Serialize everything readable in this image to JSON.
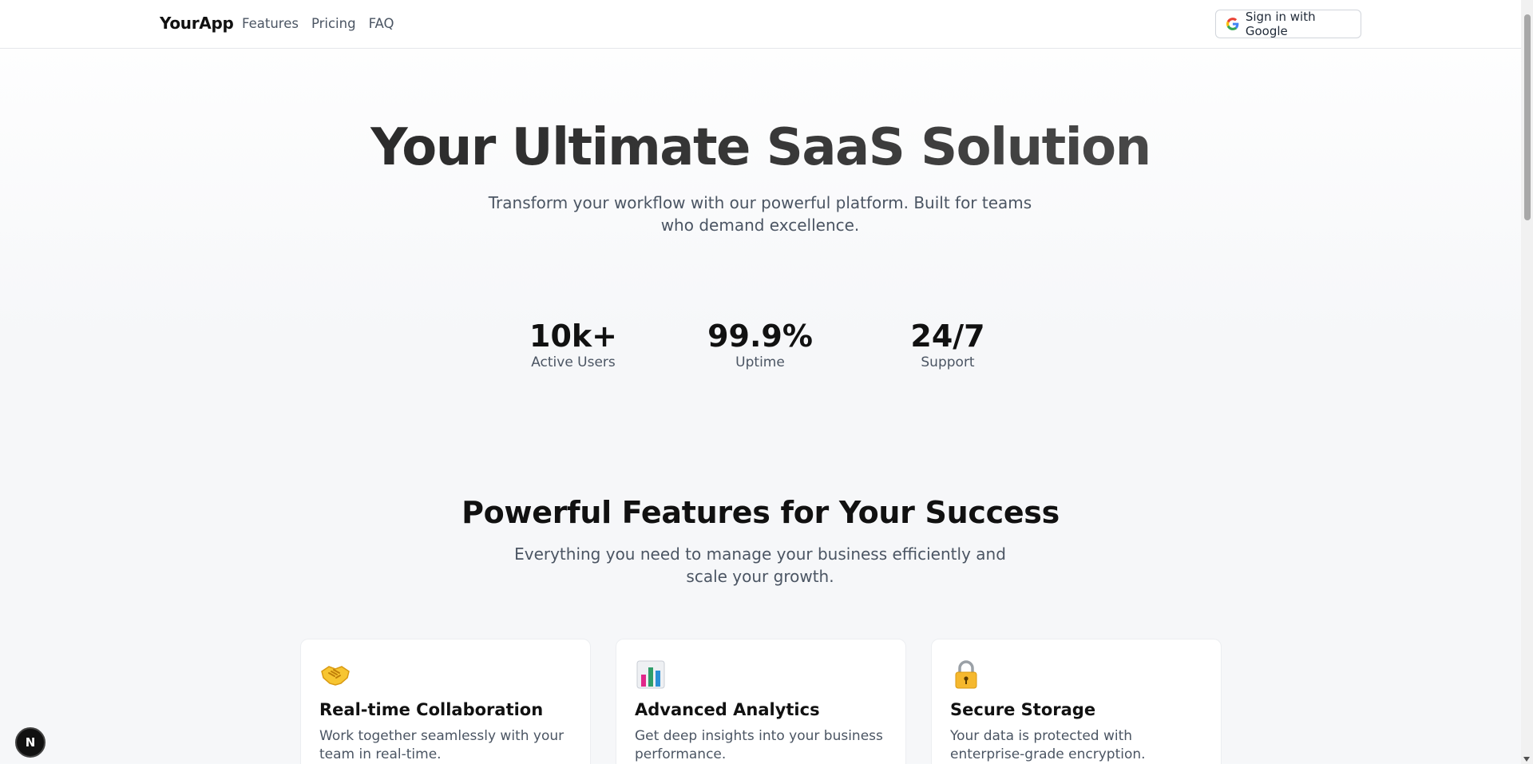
{
  "header": {
    "brand": "YourApp",
    "nav": [
      "Features",
      "Pricing",
      "FAQ"
    ],
    "signin_label": "Sign in with Google"
  },
  "hero": {
    "title": "Your Ultimate SaaS Solution",
    "subtitle": "Transform your workflow with our powerful platform. Built for teams who demand excellence."
  },
  "stats": [
    {
      "value": "10k+",
      "label": "Active Users"
    },
    {
      "value": "99.9%",
      "label": "Uptime"
    },
    {
      "value": "24/7",
      "label": "Support"
    }
  ],
  "features": {
    "title": "Powerful Features for Your Success",
    "subtitle": "Everything you need to manage your business efficiently and scale your growth.",
    "cards": [
      {
        "icon": "handshake-icon",
        "title": "Real-time Collaboration",
        "desc": "Work together seamlessly with your team in real-time."
      },
      {
        "icon": "bar-chart-icon",
        "title": "Advanced Analytics",
        "desc": "Get deep insights into your business performance."
      },
      {
        "icon": "lock-icon",
        "title": "Secure Storage",
        "desc": "Your data is protected with enterprise-grade encryption."
      }
    ]
  },
  "badge": "N"
}
